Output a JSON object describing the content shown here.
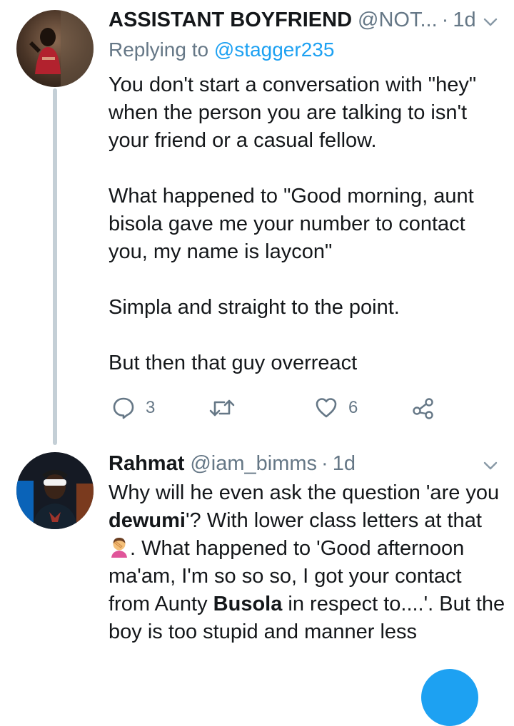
{
  "tweets": [
    {
      "display_name": "ASSISTANT BOYFRIEND",
      "handle": "@NOT...",
      "separator": "·",
      "time": "1d",
      "replying_prefix": "Replying to",
      "replying_to": "@stagger235",
      "paragraphs": [
        "You don't start a conversation with \"hey\" when the person you are talking to isn't your friend or a casual fellow.",
        "What happened to \"Good morning, aunt bisola gave me your number to contact you, my name is laycon\"",
        "Simpla and straight to the point.",
        "But then that guy overreact"
      ],
      "actions": {
        "reply_count": "3",
        "retweet_count": "",
        "like_count": "6"
      }
    },
    {
      "display_name": "Rahmat",
      "handle": "@iam_bimms",
      "separator": "·",
      "time": "1d",
      "body": {
        "t1": "Why will he even ask the question 'are you ",
        "b1": "dewumi",
        "t2": "'? With lower class letters at that",
        "t3": ". What happened to 'Good afternoon ma'am, I'm so so so, I got your contact from Aunty ",
        "b2": "Busola",
        "t4": " in respect to....'. But the boy is too stupid and manner less"
      }
    }
  ],
  "icons": {
    "reply": "reply-icon",
    "retweet": "retweet-icon",
    "like": "heart-icon",
    "share": "share-icon",
    "more": "chevron-down-icon",
    "emoji": "face-palm-emoji"
  },
  "colors": {
    "link": "#1da1f2",
    "secondary": "#657786",
    "thread": "#c4cfd6"
  }
}
